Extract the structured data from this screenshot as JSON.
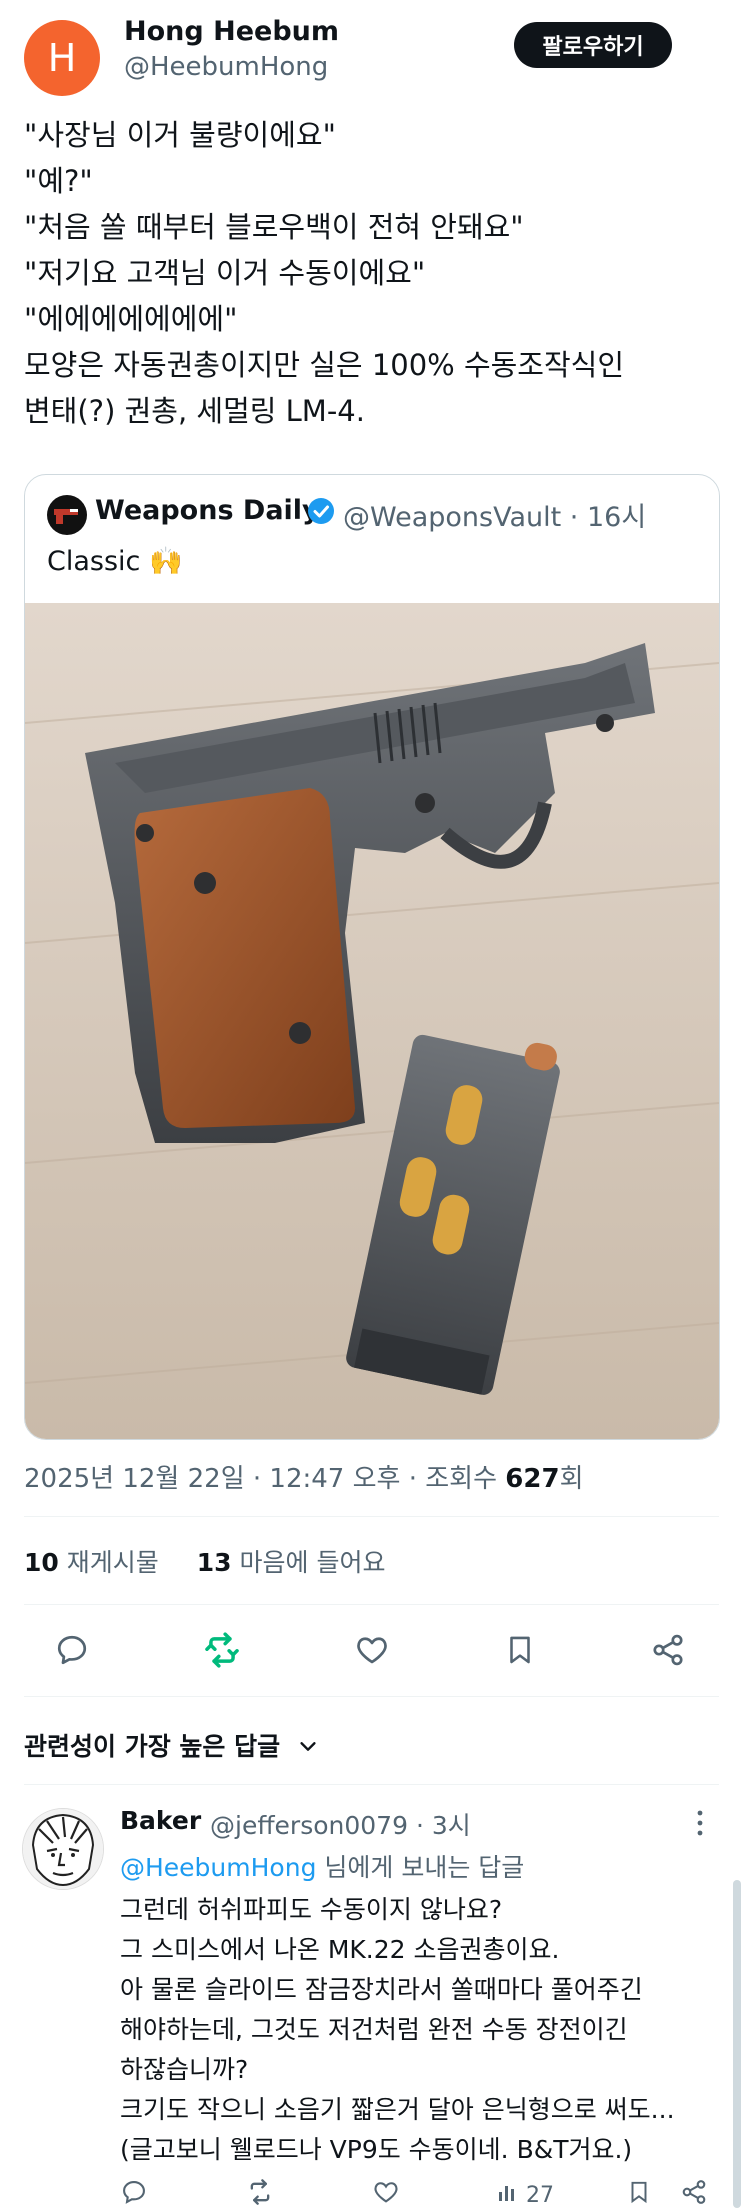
{
  "author": {
    "avatar_letter": "H",
    "name": "Hong Heebum",
    "handle": "@HeebumHong",
    "follow_label": "팔로우하기"
  },
  "tweet": {
    "lines": [
      "\"사장님 이거 불량이에요\"",
      "\"예?\"",
      "\"처음 쏠 때부터 블로우백이 전혀 안돼요\"",
      "\"저기요 고객님 이거 수동이에요\"",
      "\"에에에에에에에\"",
      "모양은 자동권총이지만 실은 100% 수동조작식인",
      "변태(?) 권총, 세멀링 LM-4."
    ]
  },
  "quoted": {
    "name": "Weapons Daily",
    "handle_time": "@WeaponsVault · 16시",
    "text": "Classic 🙌",
    "image_alt": "pistol-with-wooden-grip-and-magazine"
  },
  "meta": {
    "date": "2025년 12월 22일 · 12:47 오후 · 조회수 ",
    "views": "627",
    "views_suffix": "회"
  },
  "stats": {
    "reposts_count": "10",
    "reposts_label": "재게시물",
    "likes_count": "13",
    "likes_label": "마음에 들어요"
  },
  "actions": [
    "reply-icon",
    "repost-icon",
    "like-icon",
    "bookmark-icon",
    "share-icon"
  ],
  "colors": {
    "repost_green": "#00ba7c",
    "link_blue": "#1d9bf0",
    "avatar_orange": "#f4642e"
  },
  "replies_sort": {
    "label": "관련성이 가장 높은 답글"
  },
  "reply": {
    "name": "Baker",
    "handle_time": "@jefferson0079 · 3시",
    "reply_to_mention": "@HeebumHong",
    "reply_to_suffix": " 님에게 보내는 답글",
    "lines": [
      "그런데 허쉬파피도 수동이지 않나요?",
      "그 스미스에서 나온 MK.22 소음권총이요.",
      "아 물론 슬라이드 잠금장치라서 쏠때마다 풀어주긴",
      "해야하는데, 그것도 저건처럼 완전 수동 장전이긴",
      "하잖습니까?",
      "크기도 작으니 소음기 짧은거 달아 은닉형으로 써도...",
      "(글고보니 웰로드나 VP9도 수동이네. B&T거요.)"
    ],
    "views": "27"
  }
}
